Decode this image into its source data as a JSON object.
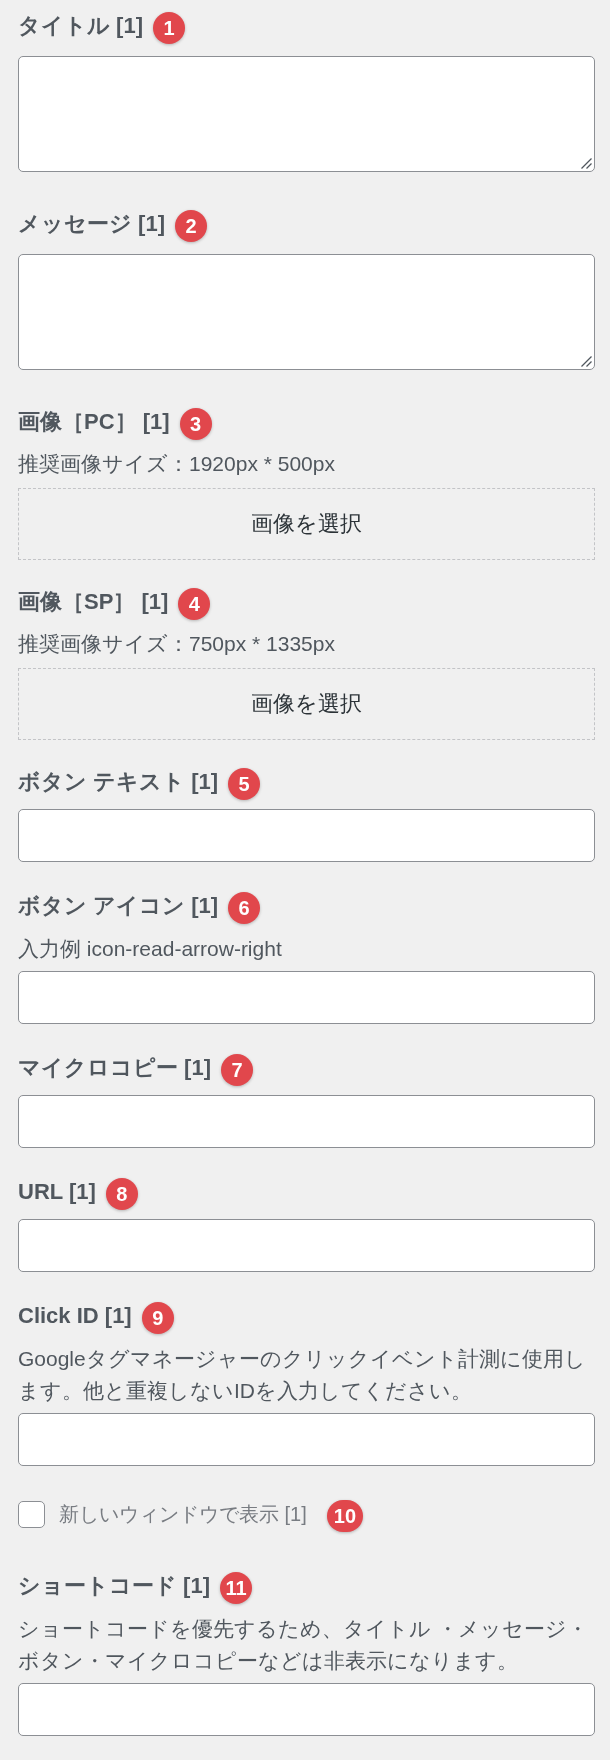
{
  "fields": [
    {
      "kind": "textarea",
      "label": "タイトル [1]",
      "badge": "1"
    },
    {
      "kind": "textarea",
      "label": "メッセージ [1]",
      "badge": "2"
    },
    {
      "kind": "image",
      "label": "画像［PC］ [1]",
      "badge": "3",
      "description": "推奨画像サイズ：1920px * 500px",
      "button": "画像を選択"
    },
    {
      "kind": "image",
      "label": "画像［SP］ [1]",
      "badge": "4",
      "description": "推奨画像サイズ：750px * 1335px",
      "button": "画像を選択"
    },
    {
      "kind": "text",
      "label": "ボタン テキスト [1]",
      "badge": "5"
    },
    {
      "kind": "text",
      "label": "ボタン アイコン [1]",
      "badge": "6",
      "description": "入力例 icon-read-arrow-right"
    },
    {
      "kind": "text",
      "label": "マイクロコピー [1]",
      "badge": "7"
    },
    {
      "kind": "text",
      "label": "URL [1]",
      "badge": "8"
    },
    {
      "kind": "text",
      "label": "Click ID [1]",
      "badge": "9",
      "description": "Googleタグマネージャーのクリックイベント計測に使用します。他と重複しないIDを入力してください。"
    },
    {
      "kind": "checkbox",
      "label": "新しいウィンドウで表示 [1]",
      "badge": "10",
      "checked": false
    },
    {
      "kind": "text",
      "label": "ショートコード [1]",
      "badge": "11",
      "description": "ショートコードを優先するため、タイトル ・メッセージ・ボタン・マイクロコピーなどは非表示になります。"
    }
  ]
}
